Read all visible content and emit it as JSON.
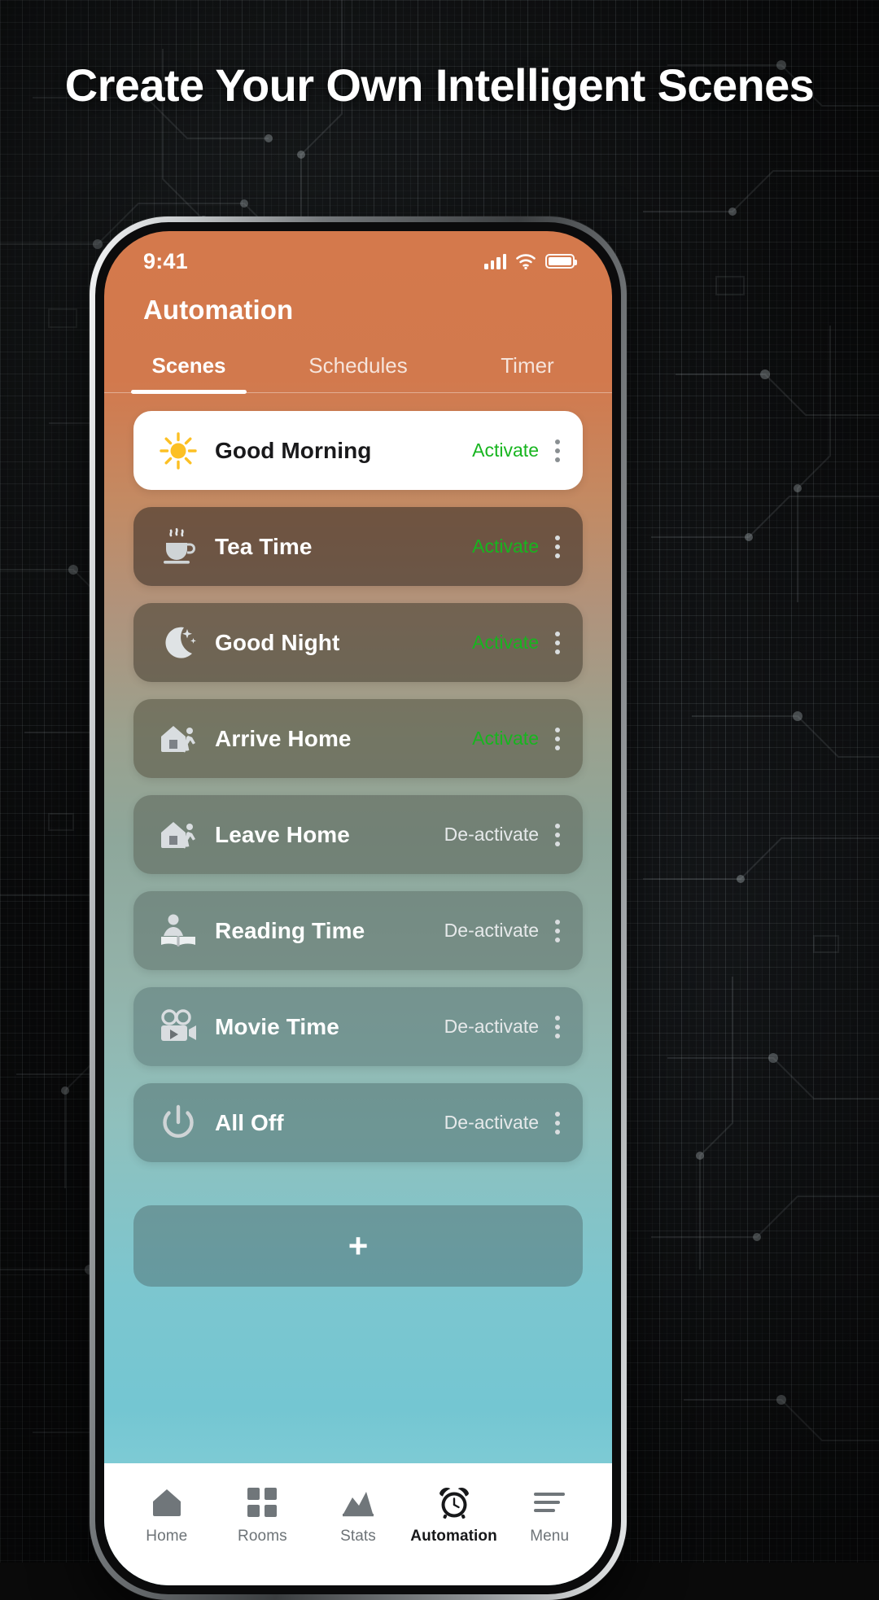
{
  "headline": "Create Your Own Intelligent Scenes",
  "colors": {
    "header_orange": "#d4794c",
    "screen_bottom_teal": "#8ed2d8",
    "activate_green": "#17b51f",
    "deactivate_grey": "#e6e9ea",
    "card_white": "#ffffff",
    "sun_yellow": "#fcc024",
    "background_dark": "#0c0d0e"
  },
  "status_bar": {
    "time": "9:41",
    "signal_icon": "cellular-bars-icon",
    "wifi_icon": "wifi-icon",
    "battery_icon": "battery-full-icon"
  },
  "header": {
    "title": "Automation",
    "tabs": [
      {
        "label": "Scenes",
        "active": true
      },
      {
        "label": "Schedules",
        "active": false
      },
      {
        "label": "Timer",
        "active": false
      }
    ]
  },
  "scenes": [
    {
      "name": "Good Morning",
      "action": "Activate",
      "state": "on",
      "icon": "sun-icon",
      "style": "light"
    },
    {
      "name": "Tea Time",
      "action": "Activate",
      "state": "on",
      "icon": "teacup-icon",
      "style": "tinted"
    },
    {
      "name": "Good Night",
      "action": "Activate",
      "state": "on",
      "icon": "moon-icon",
      "style": "tinted"
    },
    {
      "name": "Arrive Home",
      "action": "Activate",
      "state": "on",
      "icon": "arrive-home-icon",
      "style": "tinted"
    },
    {
      "name": "Leave Home",
      "action": "De-activate",
      "state": "off",
      "icon": "leave-home-icon",
      "style": "tinted"
    },
    {
      "name": "Reading Time",
      "action": "De-activate",
      "state": "off",
      "icon": "reading-icon",
      "style": "tinted"
    },
    {
      "name": "Movie Time",
      "action": "De-activate",
      "state": "off",
      "icon": "movie-camera-icon",
      "style": "tinted"
    },
    {
      "name": "All Off",
      "action": "De-activate",
      "state": "off",
      "icon": "power-icon",
      "style": "tinted"
    }
  ],
  "add_scene": {
    "label": "+"
  },
  "bottom_nav": [
    {
      "label": "Home",
      "icon": "home-icon",
      "active": false
    },
    {
      "label": "Rooms",
      "icon": "grid-icon",
      "active": false
    },
    {
      "label": "Stats",
      "icon": "chart-icon",
      "active": false
    },
    {
      "label": "Automation",
      "icon": "alarm-clock-icon",
      "active": true
    },
    {
      "label": "Menu",
      "icon": "hamburger-icon",
      "active": false
    }
  ],
  "kebab_menu": {
    "icon": "more-vertical-icon"
  }
}
